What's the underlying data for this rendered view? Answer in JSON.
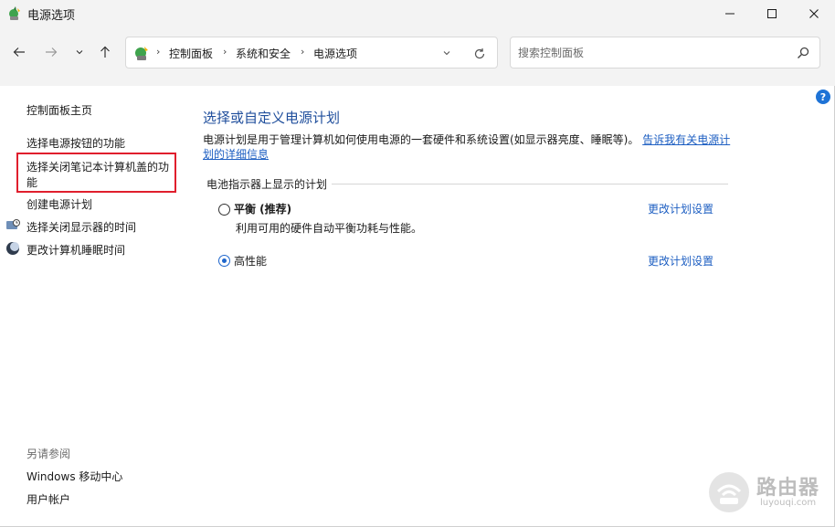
{
  "window": {
    "title": "电源选项"
  },
  "address": {
    "crumbs": [
      "控制面板",
      "系统和安全",
      "电源选项"
    ]
  },
  "search": {
    "placeholder": "搜索控制面板"
  },
  "sidebar": {
    "home": "控制面板主页",
    "links": [
      "选择电源按钮的功能",
      "选择关闭笔记本计算机盖的功",
      "能",
      "创建电源计划",
      "选择关闭显示器的时间",
      "更改计算机睡眠时间"
    ],
    "see_also": "另请参阅",
    "see_also_links": [
      "Windows 移动中心",
      "用户帐户"
    ]
  },
  "main": {
    "title": "选择或自定义电源计划",
    "description": "电源计划是用于管理计算机如何使用电源的一套硬件和系统设置(如显示器亮度、睡眠等)。",
    "learn_more_line1": "告诉我有关电源计",
    "learn_more_line2": "划的详细信息",
    "group_label": "电池指示器上显示的计划",
    "plans": [
      {
        "name": "平衡 (推荐)",
        "description": "利用可用的硬件自动平衡功耗与性能。",
        "change": "更改计划设置",
        "selected": false
      },
      {
        "name": "高性能",
        "description": "",
        "change": "更改计划设置",
        "selected": true
      }
    ]
  },
  "help_label": "?",
  "watermark": {
    "text": "路由器",
    "sub": "luyouqi.com"
  },
  "colors": {
    "accent": "#1e66cc",
    "link": "#1e5fc2",
    "title": "#1f4e9c",
    "highlight": "#e01e2d"
  }
}
